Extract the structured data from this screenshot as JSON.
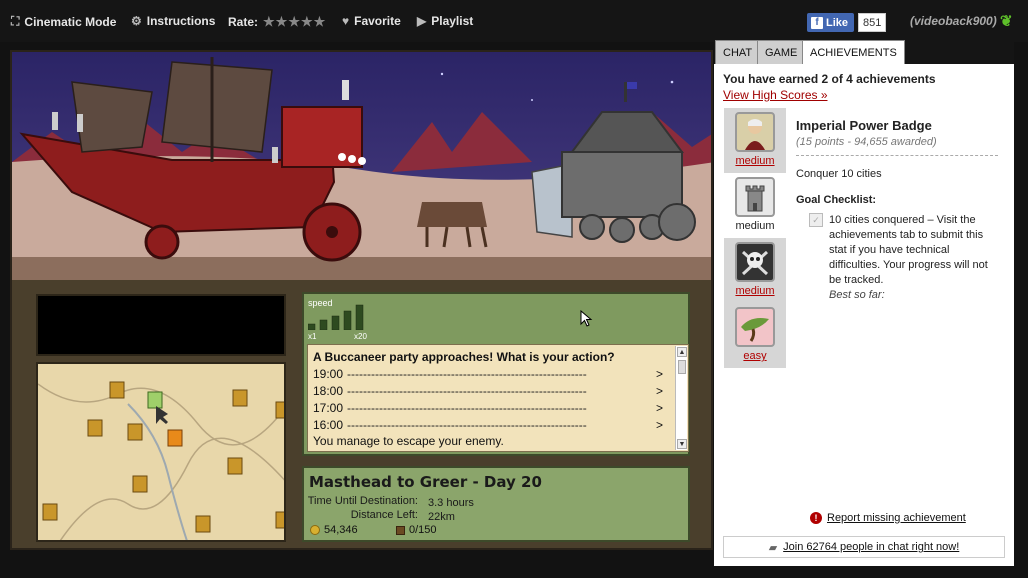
{
  "topbar": {
    "cinematic": "Cinematic Mode",
    "instructions": "Instructions",
    "rate": "Rate:",
    "stars": "★★★★★",
    "favorite": "Favorite",
    "playlist": "Playlist",
    "fb_like": "Like",
    "fb_count": "851",
    "username": "(videoback900)"
  },
  "game": {
    "speed_label": "speed",
    "speed_min": "x1",
    "speed_max": "x20",
    "event_title": "A Buccaneer party approaches!  What is your action?",
    "event_rows": [
      {
        "time": "19:00",
        "dashes": "------------------------------------------------------------",
        "arrow": ">"
      },
      {
        "time": "18:00",
        "dashes": "------------------------------------------------------------",
        "arrow": ">"
      },
      {
        "time": "17:00",
        "dashes": "------------------------------------------------------------",
        "arrow": ">"
      },
      {
        "time": "16:00",
        "dashes": "------------------------------------------------------------",
        "arrow": ">"
      }
    ],
    "event_message": "You manage to escape your enemy.",
    "route_title": "Masthead to Greer - Day 20",
    "time_label": "Time Until Destination:",
    "time_value": "3.3 hours",
    "distance_label": "Distance Left:",
    "distance_value": "22km",
    "gold": "54,346",
    "cargo": "0/150"
  },
  "side": {
    "tabs": [
      {
        "label": "CHAT",
        "active": false
      },
      {
        "label": "GAME",
        "active": false
      },
      {
        "label": "ACHIEVEMENTS",
        "active": true
      }
    ],
    "earned": "You have earned 2 of 4 achievements",
    "high_scores": "View High Scores »",
    "achievements": [
      {
        "level": "medium",
        "icon": "warrior-badge-icon"
      },
      {
        "level": "medium",
        "icon": "tower-icon"
      },
      {
        "level": "medium",
        "icon": "skull-crossbones-icon"
      },
      {
        "level": "easy",
        "icon": "bonsai-tree-icon"
      }
    ],
    "detail": {
      "title": "Imperial Power Badge",
      "subtitle": "(15 points - 94,655 awarded)",
      "description": "Conquer 10 cities",
      "goal_heading": "Goal Checklist:",
      "check_text": "10 cities conquered – Visit the achievements tab to submit this stat if you have technical difficulties. Your progress will not be tracked.",
      "best": "Best so far:"
    },
    "report": "Report missing achievement",
    "join": "Join 62764 people in chat right now!"
  }
}
